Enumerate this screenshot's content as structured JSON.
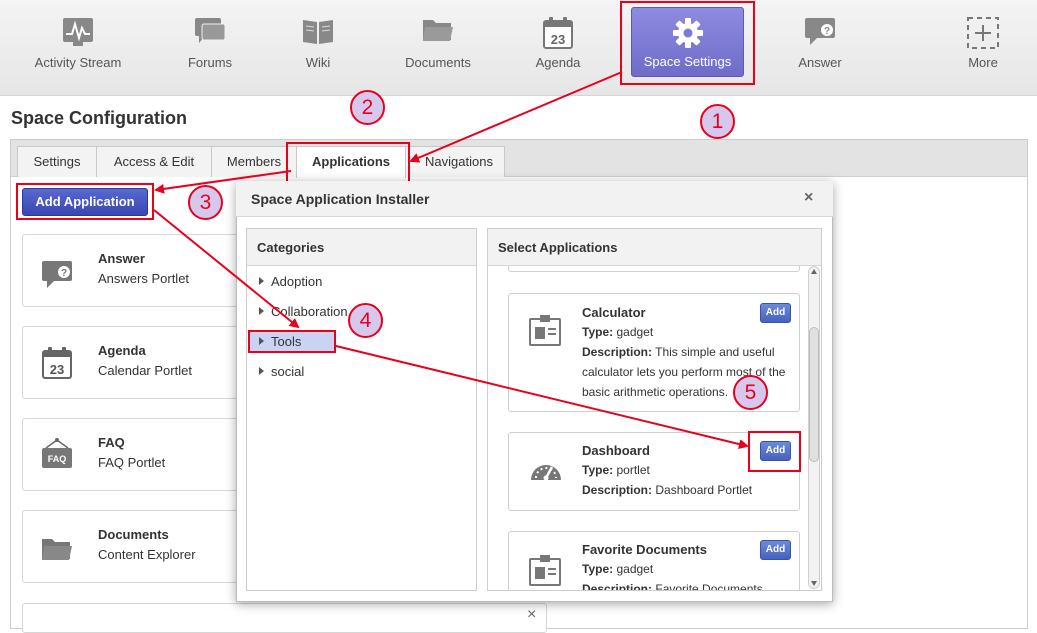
{
  "nav": {
    "items": [
      {
        "label": "Activity Stream",
        "icon": "activity-stream-icon"
      },
      {
        "label": "Forums",
        "icon": "forums-icon"
      },
      {
        "label": "Wiki",
        "icon": "wiki-icon"
      },
      {
        "label": "Documents",
        "icon": "documents-icon"
      },
      {
        "label": "Agenda",
        "icon": "agenda-icon",
        "icon_text": "23"
      },
      {
        "label": "Space Settings",
        "icon": "gear-icon",
        "active": true
      },
      {
        "label": "Answer",
        "icon": "answer-icon"
      },
      {
        "label": "More",
        "icon": "plus-icon"
      }
    ]
  },
  "page_title": "Space Configuration",
  "tabs": [
    {
      "label": "Settings"
    },
    {
      "label": "Access & Edit"
    },
    {
      "label": "Members"
    },
    {
      "label": "Applications",
      "active": true
    },
    {
      "label": "Navigations"
    }
  ],
  "add_application_label": "Add Application",
  "apps": [
    {
      "title": "Answer",
      "subtitle": "Answers Portlet",
      "icon": "answer-icon"
    },
    {
      "title": "Agenda",
      "subtitle": "Calendar Portlet",
      "icon": "agenda-icon",
      "icon_text": "23"
    },
    {
      "title": "FAQ",
      "subtitle": "FAQ Portlet",
      "icon": "faq-icon",
      "icon_text": "FAQ"
    },
    {
      "title": "Documents",
      "subtitle": "Content Explorer",
      "icon": "documents-icon"
    }
  ],
  "installer": {
    "title": "Space Application Installer",
    "close_glyph": "×",
    "categories_header": "Categories",
    "categories": [
      "Adoption",
      "Collaboration",
      "Tools",
      "social"
    ],
    "selected_category": "Tools",
    "apps_header": "Select Applications",
    "gadgets": [
      {
        "title": "Calculator",
        "type_label": "Type:",
        "type": "gadget",
        "desc_label": "Description:",
        "description": "This simple and useful calculator lets you perform most of the basic arithmetic operations.",
        "add_label": "Add",
        "icon": "calculator-icon"
      },
      {
        "title": "Dashboard",
        "type_label": "Type:",
        "type": "portlet",
        "desc_label": "Description:",
        "description": "Dashboard Portlet",
        "add_label": "Add",
        "icon": "dashboard-icon"
      },
      {
        "title": "Favorite Documents",
        "type_label": "Type:",
        "type": "gadget",
        "desc_label": "Description:",
        "description": "Favorite Documents",
        "add_label": "Add",
        "icon": "favorite-documents-icon"
      }
    ]
  },
  "bottom_close_glyph": "×",
  "steps": [
    "1",
    "2",
    "3",
    "4",
    "5"
  ],
  "colors": {
    "annotation_red": "#e8001c",
    "active_nav": "#7b79d6",
    "add_button": "#3a47b3",
    "step_fill": "#d6c8ec"
  }
}
